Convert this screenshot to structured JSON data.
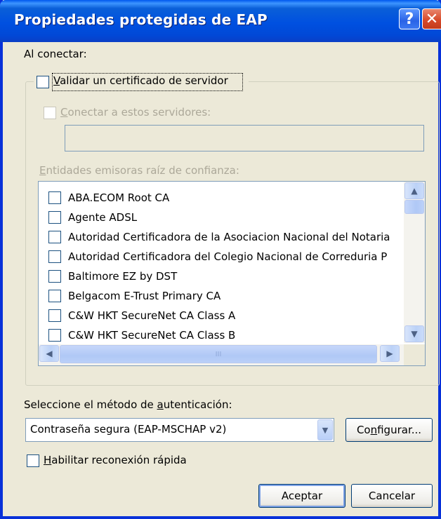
{
  "window": {
    "title": "Propiedades protegidas de EAP",
    "help_glyph": "?",
    "close_glyph": "✕"
  },
  "connect_label": "Al conectar:",
  "validate_cert": {
    "label_u": "V",
    "label_rest": "alidar un certificado de servidor",
    "checked": false
  },
  "connect_servers": {
    "label_u": "C",
    "label_rest": "onectar a estos servidores:",
    "value": "",
    "enabled": false
  },
  "trusted_roots": {
    "label_u": "E",
    "label_rest": "ntidades emisoras raíz de confianza:",
    "items": [
      "ABA.ECOM Root CA",
      "Agente ADSL",
      "Autoridad Certificadora de la Asociacion Nacional del Notaria",
      "Autoridad Certificadora del Colegio Nacional de Correduria P",
      "Baltimore EZ by DST",
      "Belgacom E-Trust Primary CA",
      "C&W HKT SecureNet CA Class A",
      "C&W HKT SecureNet CA Class B"
    ]
  },
  "auth_method": {
    "label_pre": "Seleccione el método de ",
    "label_u": "a",
    "label_rest": "utenticación:",
    "selected": "Contraseña segura (EAP-MSCHAP v2)",
    "configure_pre": "Co",
    "configure_u": "n",
    "configure_rest": "figurar..."
  },
  "fast_reconnect": {
    "label_u": "H",
    "label_rest": "abilitar reconexión rápida",
    "checked": false
  },
  "buttons": {
    "ok": "Aceptar",
    "cancel": "Cancelar"
  },
  "icons": {
    "up": "▲",
    "down": "▼",
    "left": "◀",
    "right": "▶",
    "grip": "III"
  }
}
